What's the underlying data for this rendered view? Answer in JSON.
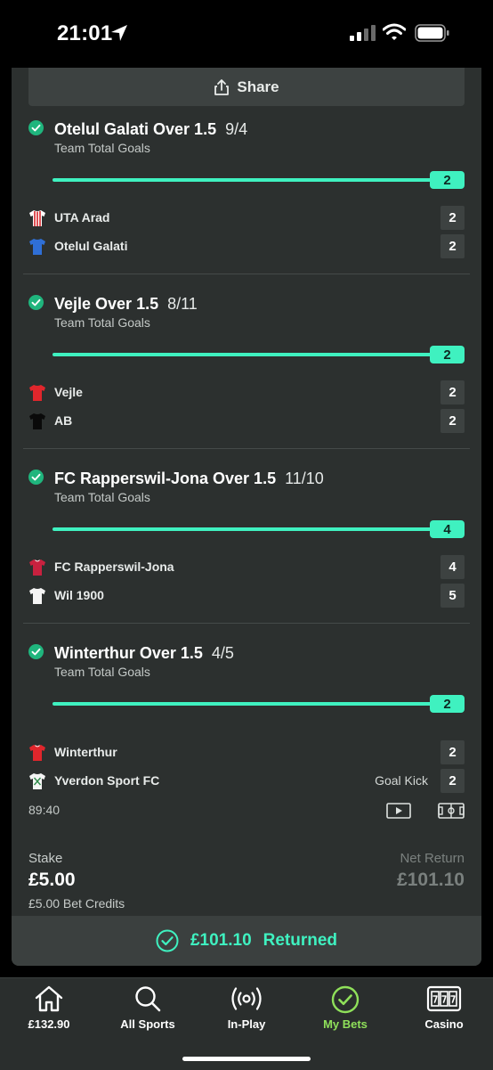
{
  "status_bar": {
    "time": "21:01"
  },
  "share": {
    "label": "Share"
  },
  "legs": [
    {
      "selection": "Otelul Galati Over 1.5",
      "odds": "9/4",
      "market": "Team Total Goals",
      "progress_value": "2",
      "teams": [
        {
          "name": "UTA Arad",
          "score": "2",
          "kit": "striped-red-white"
        },
        {
          "name": "Otelul Galati",
          "score": "2",
          "kit": "blue"
        }
      ]
    },
    {
      "selection": "Vejle Over 1.5",
      "odds": "8/11",
      "market": "Team Total Goals",
      "progress_value": "2",
      "teams": [
        {
          "name": "Vejle",
          "score": "2",
          "kit": "red"
        },
        {
          "name": "AB",
          "score": "2",
          "kit": "black"
        }
      ]
    },
    {
      "selection": "FC Rapperswil-Jona Over 1.5",
      "odds": "11/10",
      "market": "Team Total Goals",
      "progress_value": "4",
      "teams": [
        {
          "name": "FC Rapperswil-Jona",
          "score": "4",
          "kit": "crimson"
        },
        {
          "name": "Wil 1900",
          "score": "5",
          "kit": "white"
        }
      ]
    },
    {
      "selection": "Winterthur Over 1.5",
      "odds": "4/5",
      "market": "Team Total Goals",
      "progress_value": "2",
      "teams": [
        {
          "name": "Winterthur",
          "score": "2",
          "kit": "red"
        },
        {
          "name": "Yverdon Sport FC",
          "score": "2",
          "kit": "white-green"
        }
      ],
      "live_status": "Goal Kick",
      "match_clock": "89:40"
    }
  ],
  "summary": {
    "stake_label": "Stake",
    "stake_value": "£5.00",
    "stake_credits": "£5.00 Bet Credits",
    "net_return_label": "Net Return",
    "net_return_value": "£101.10"
  },
  "returned": {
    "amount": "£101.10",
    "label": "Returned"
  },
  "nav": [
    {
      "label": "£132.90",
      "icon": "home-icon"
    },
    {
      "label": "All Sports",
      "icon": "search-icon"
    },
    {
      "label": "In-Play",
      "icon": "live-broadcast-icon"
    },
    {
      "label": "My Bets",
      "icon": "check-circle-icon",
      "active": true
    },
    {
      "label": "Casino",
      "icon": "slot-machine-icon"
    }
  ],
  "colors": {
    "accent": "#3ff1c0",
    "active_nav": "#8fe05a",
    "card_bg": "#2c302f",
    "check_green": "#1fb57d"
  }
}
